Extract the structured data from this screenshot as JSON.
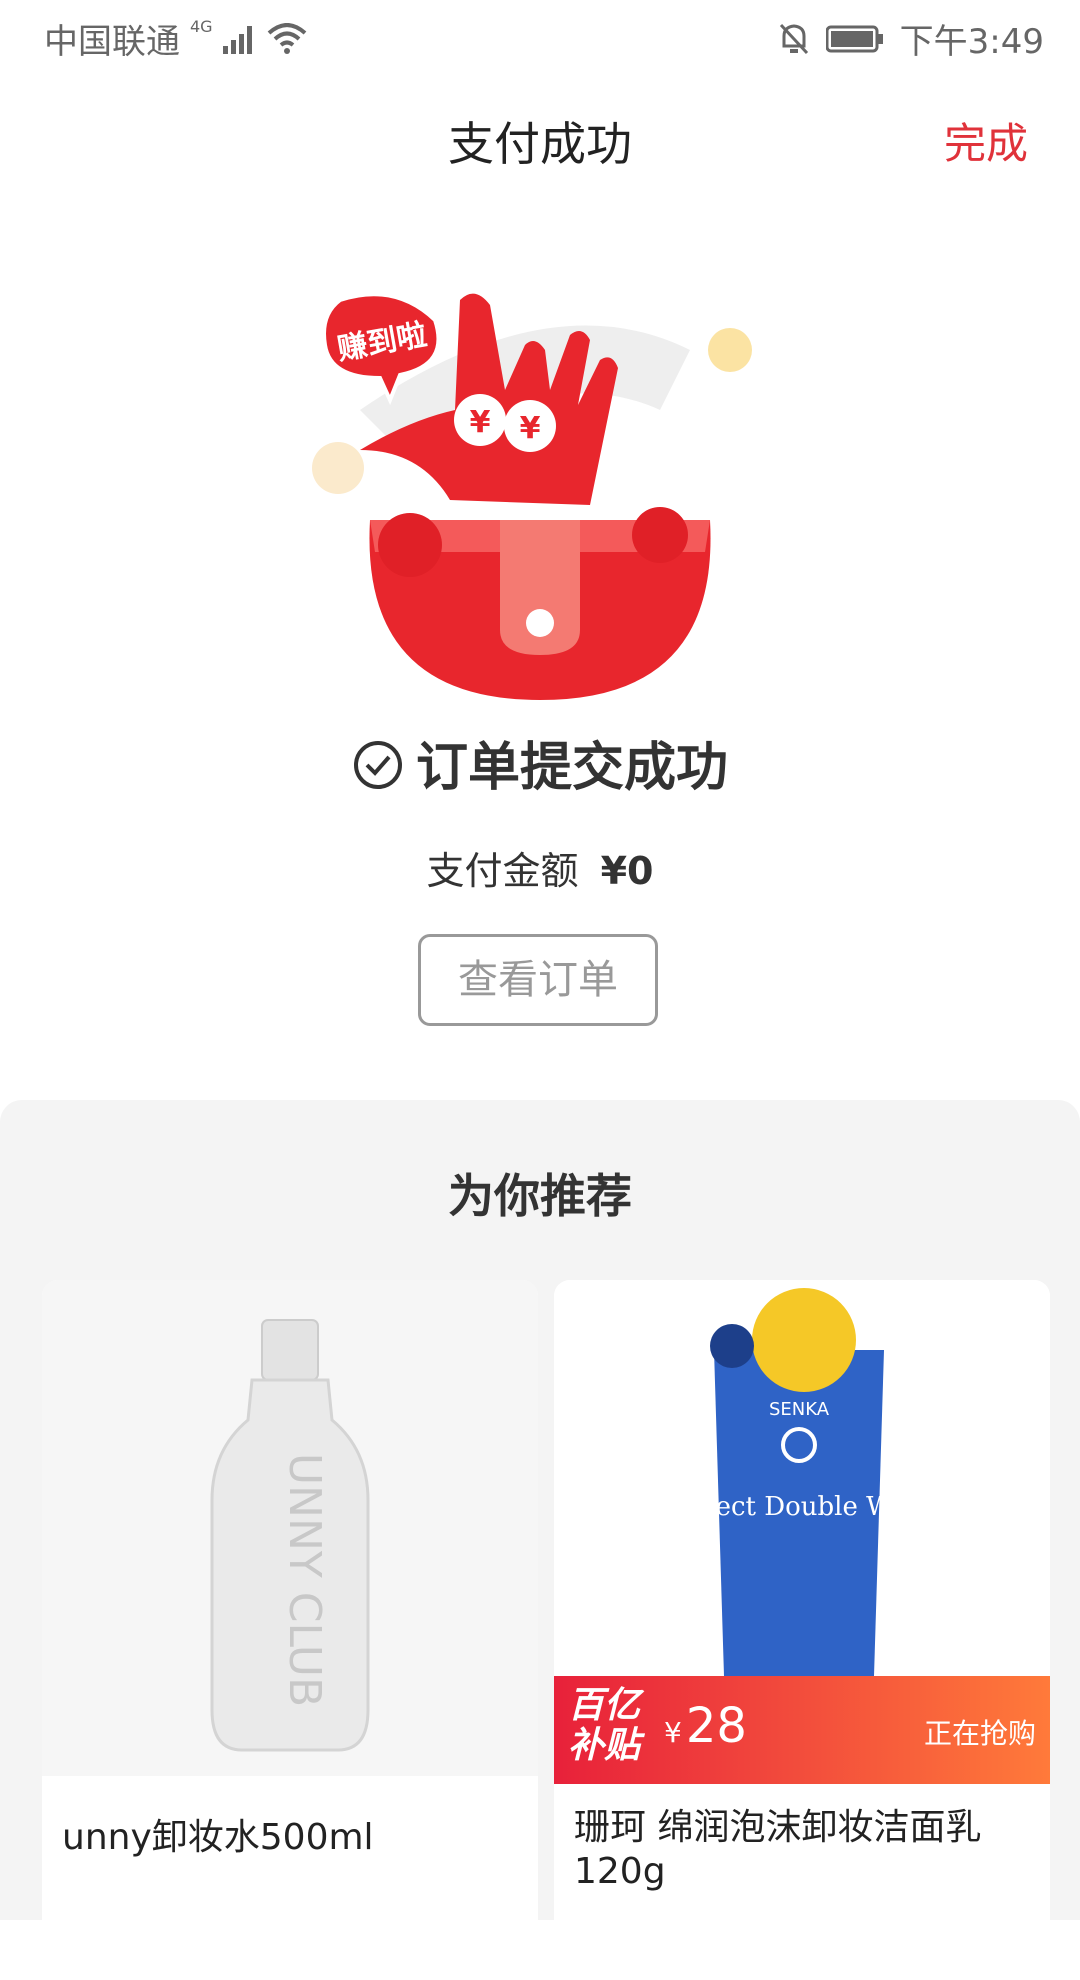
{
  "status_bar": {
    "carrier": "中国联通",
    "network": "4G",
    "time": "下午3:49"
  },
  "nav": {
    "title": "支付成功",
    "done": "完成"
  },
  "hero": {
    "speech_bubble": "赚到啦",
    "coin_symbol": "¥"
  },
  "order": {
    "status": "订单提交成功",
    "pay_label": "支付金额",
    "pay_amount": "¥0",
    "view_button": "查看订单"
  },
  "recommend": {
    "title": "为你推荐",
    "products": [
      {
        "name": "unny卸妆水500ml",
        "image_text": "UNNY CLUB"
      },
      {
        "name": "珊珂 绵润泡沫卸妆洁面乳120g",
        "image_text_1": "SENKA",
        "image_text_2": "Perfect Double Wash",
        "badge": "百亿补贴",
        "currency": "¥",
        "price": "28",
        "promo": "正在抢购"
      }
    ]
  },
  "colors": {
    "accent": "#e0323a",
    "red_dark": "#d81f26",
    "bg_grey": "#f4f4f4"
  }
}
